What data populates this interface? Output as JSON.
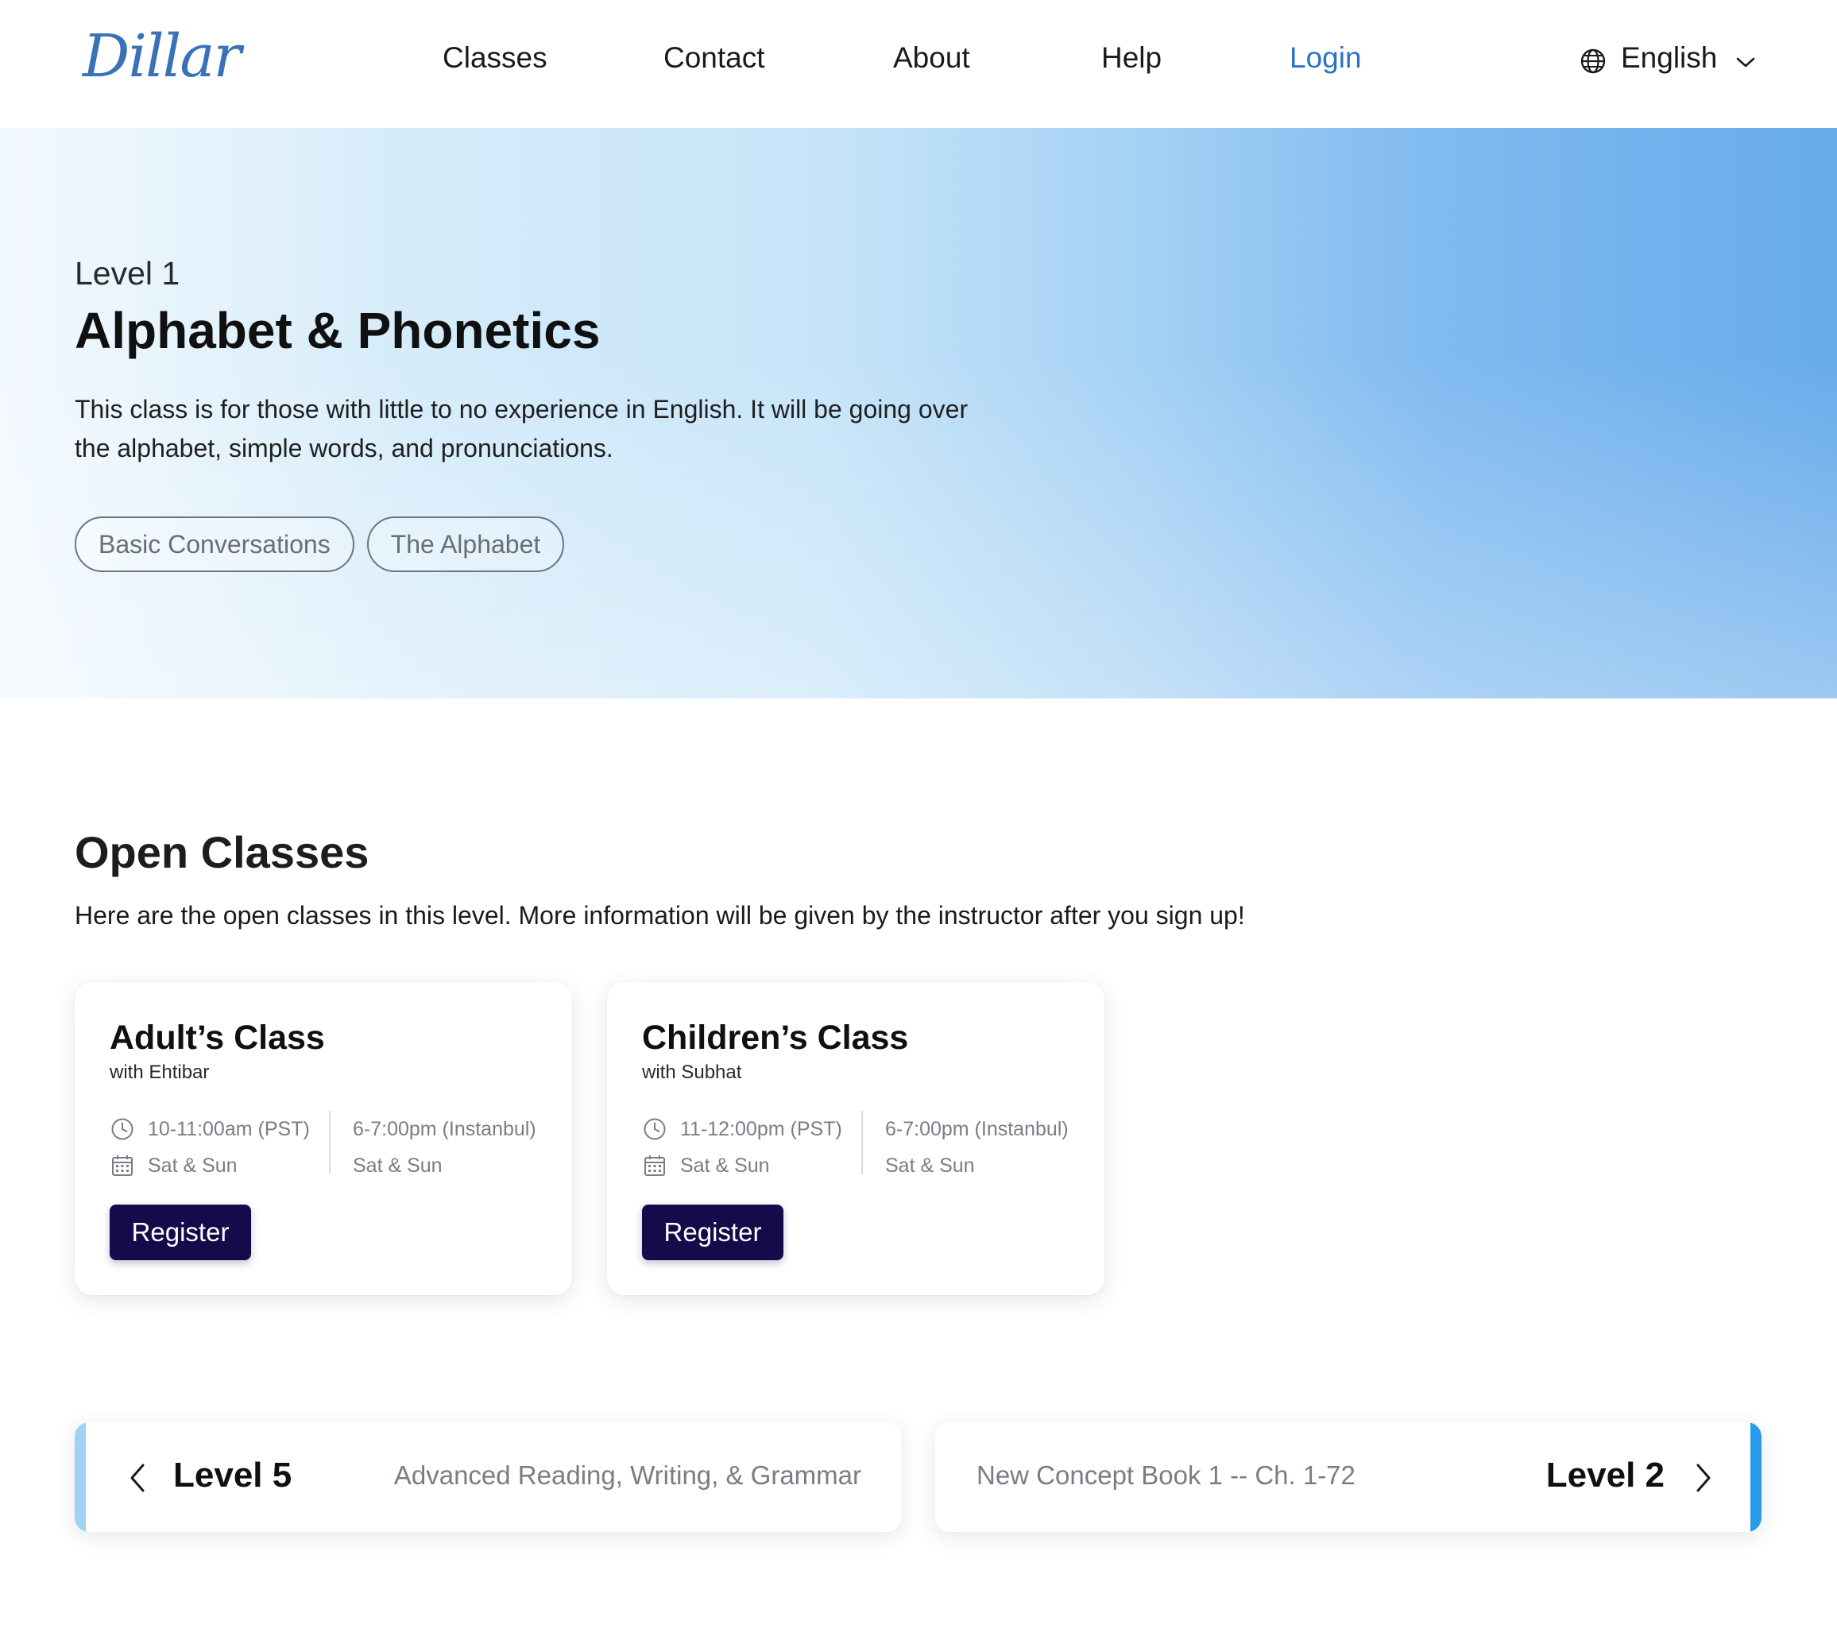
{
  "brand": {
    "logo_text": "Dillar",
    "logo_color": "#3a72b8"
  },
  "nav": {
    "items": [
      {
        "label": "Classes"
      },
      {
        "label": "Contact"
      },
      {
        "label": "About"
      },
      {
        "label": "Help"
      },
      {
        "label": "Login"
      }
    ],
    "language": {
      "label": "English",
      "icon": "globe-icon"
    }
  },
  "hero": {
    "level": "Level 1",
    "title": "Alphabet & Phonetics",
    "description": "This class is for those with little to no experience in English. It will be going over the alphabet, simple words, and pronunciations.",
    "tags": [
      "Basic Conversations",
      "The Alphabet"
    ]
  },
  "open_classes": {
    "title": "Open Classes",
    "subtitle": "Here are the open classes in this level. More information will be given by the instructor after you sign up!",
    "cards": [
      {
        "title": "Adult’s Class",
        "instructor": "with Ehtibar",
        "time_local": "10-11:00am (PST)",
        "days_local": "Sat & Sun",
        "time_other": "6-7:00pm (Instanbul)",
        "days_other": "Sat & Sun",
        "button": "Register"
      },
      {
        "title": "Children’s Class",
        "instructor": "with Subhat",
        "time_local": "11-12:00pm (PST)",
        "days_local": "Sat & Sun",
        "time_other": "6-7:00pm (Instanbul)",
        "days_other": "Sat & Sun",
        "button": "Register"
      }
    ]
  },
  "level_nav": {
    "previous": {
      "level": "Level 5",
      "description": "Advanced Reading, Writing, & Grammar",
      "accent": "#9fd2f3"
    },
    "next": {
      "level": "Level 2",
      "description": "New Concept Book 1 -- Ch. 1-72",
      "accent": "#2a9bea"
    }
  },
  "colors": {
    "login": "#2a73c7",
    "register_button": "#130b4a"
  }
}
